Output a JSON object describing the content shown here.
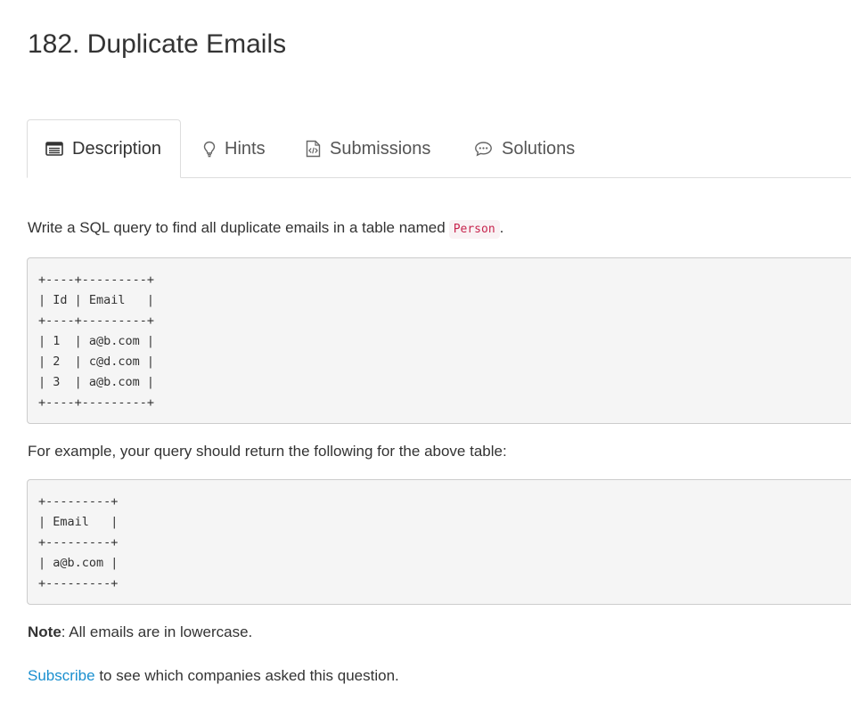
{
  "problem": {
    "title": "182. Duplicate Emails"
  },
  "tabs": [
    {
      "label": "Description",
      "icon": "list-icon",
      "active": true
    },
    {
      "label": "Hints",
      "icon": "lightbulb-icon",
      "active": false
    },
    {
      "label": "Submissions",
      "icon": "code-file-icon",
      "active": false
    },
    {
      "label": "Solutions",
      "icon": "comment-icon",
      "active": false
    }
  ],
  "description": {
    "intro_text": "Write a SQL query to find all duplicate emails in a table named",
    "table_name": "Person",
    "intro_end": ".",
    "input_table": "+----+---------+\n| Id | Email   |\n+----+---------+\n| 1  | a@b.com |\n| 2  | c@d.com |\n| 3  | a@b.com |\n+----+---------+",
    "example_text": "For example, your query should return the following for the above table:",
    "output_table": "+---------+\n| Email   |\n+---------+\n| a@b.com |\n+---------+",
    "note_label": "Note",
    "note_text": ": All emails are in lowercase.",
    "subscribe_link": "Subscribe",
    "subscribe_text": " to see which companies asked this question."
  },
  "colors": {
    "link": "#1a8fcf",
    "code_text": "#c7254e",
    "code_bg": "#f9f2f4"
  }
}
